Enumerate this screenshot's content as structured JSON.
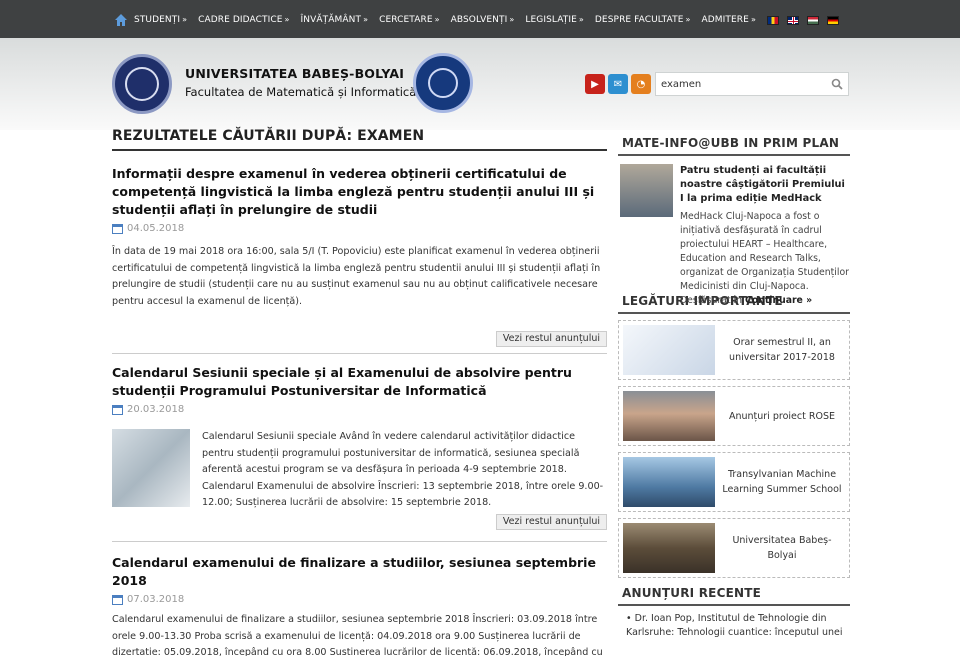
{
  "nav": {
    "items": [
      "STUDENȚI",
      "CADRE DIDACTICE",
      "ÎNVĂȚĂMÂNT",
      "CERCETARE",
      "ABSOLVENȚI",
      "LEGISLAȚIE",
      "DESPRE FACULTATE",
      "ADMITERE"
    ],
    "arrow": "»",
    "flags": [
      "ro",
      "gb",
      "hu",
      "de"
    ]
  },
  "header": {
    "university": "UNIVERSITATEA BABEȘ-BOLYAI",
    "faculty": "Facultatea de Matematică și Informatică"
  },
  "search": {
    "value": "examen",
    "icon": "search-icon"
  },
  "social": [
    "youtube-icon",
    "mail-icon",
    "rss-icon"
  ],
  "results_title": "REZULTATELE CĂUTĂRII DUPĂ: EXAMEN",
  "results": [
    {
      "title": "Informații despre examenul în vederea obținerii certificatului de competență lingvistică la limba engleză pentru studenții anului III și studenții aflați în prelungire de studii",
      "date": "04.05.2018",
      "excerpt": "În data de 19 mai 2018 ora 16:00, sala 5/I (T. Popoviciu) este planificat examenul în vederea obținerii certificatului de competență lingvistică la limba engleză pentru studentii anului III și studenții aflați în prelungire de studii (studenții care nu au susținut examenul sau nu au obținut calificativele necesare pentru accesul la examenul de licență).",
      "more": "Vezi restul anunțului"
    },
    {
      "title": "Calendarul Sesiunii speciale și al Examenului de absolvire pentru studenții Programului Postuniversitar de Informatică",
      "date": "20.03.2018",
      "excerpt": "Calendarul Sesiunii speciale Având în vedere calendarul activităților didactice pentru studenții programului postuniversitar de informatică, sesiunea specială aferentă acestui program se va desfășura în perioada 4-9 septembrie 2018. Calendarul Examenului de absolvire Înscrieri: 13 septembrie 2018, între orele 9.00-12.00; Susținerea lucrării de absolvire: 15 septembrie 2018.",
      "more": "Vezi restul anunțului"
    },
    {
      "title": "Calendarul examenului de finalizare a studiilor, sesiunea septembrie 2018",
      "date": "07.03.2018",
      "excerpt": "Calendarul examenului de finalizare a studiilor, sesiunea septembrie 2018 Înscrieri: 03.09.2018 între orele 9.00-13.30 Proba scrisă a examenului de licență: 04.09.2018 ora 9.00 Susținerea lucrării de dizertație: 05.09.2018, începând cu ora 8.00 Susținerea lucrărilor de licență: 06.09.2018, începând cu ora 8.00 Acte necesare la înscrierea la examenul de licență Cerere tip de înscriere (se va"
    }
  ],
  "sidebar": {
    "prim_title": "MATE-INFO@UBB IN PRIM PLAN",
    "prim_headline": "Patru studenți ai facultății noastre câștigătorii Premiului I la prima ediție MedHack",
    "prim_text": "MedHack Cluj-Napoca a fost o inițiativă desfășurată în cadrul proiectului HEART – Healthcare, Education and Research Talks, organizat de Organizația Studenților Medicinisti din Cluj-Napoca. Desfășurat în",
    "prim_more": "Continuare »",
    "links_title": "LEGĂTURI IMPORTANTE",
    "links": [
      {
        "label": "Orar semestrul II, an universitar 2017-2018"
      },
      {
        "label": "Anunțuri proiect ROSE"
      },
      {
        "label": "Transylvanian Machine Learning Summer School"
      },
      {
        "label": "Universitatea Babeș-Bolyai"
      }
    ],
    "announce_title": "ANUNȚURI RECENTE",
    "announce_item": "Dr. Ioan Pop, Institutul de Tehnologie din Karlsruhe: Tehnologii cuantice: începutul unei"
  }
}
